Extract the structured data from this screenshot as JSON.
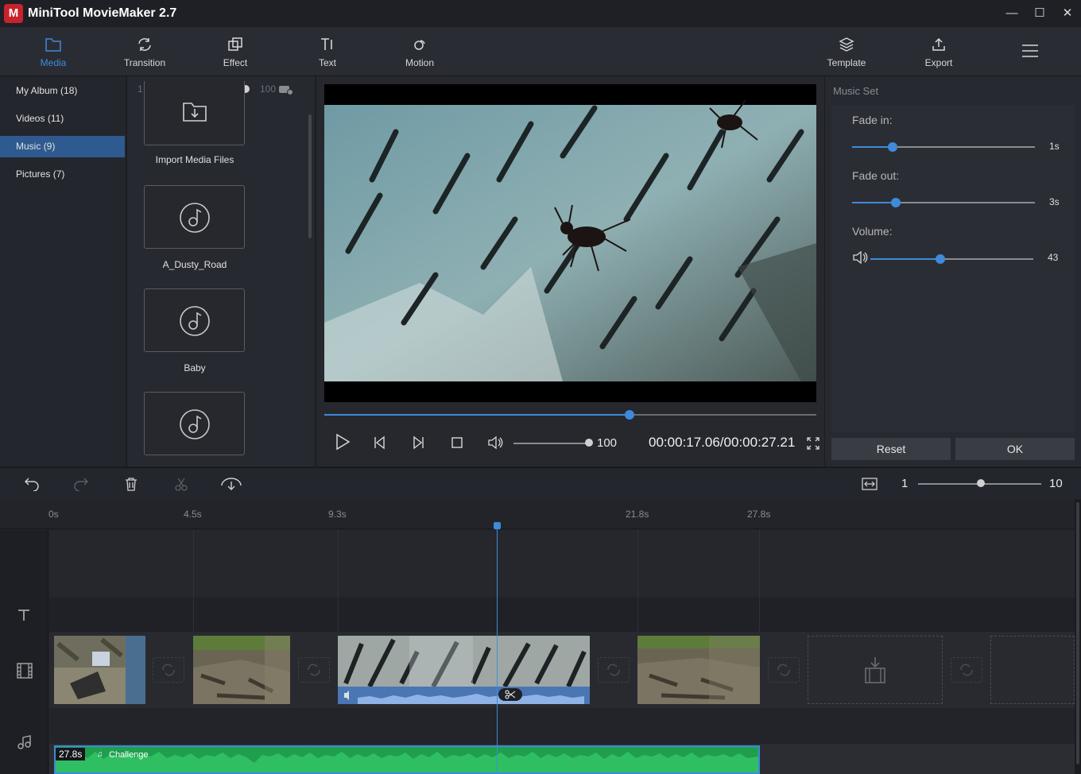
{
  "window": {
    "title": "MiniTool MovieMaker 2.7",
    "logo_glyph": "M",
    "minimize": "—",
    "maximize": "☐",
    "close": "✕"
  },
  "toolbar": {
    "tabs": [
      {
        "label": "Media",
        "icon": "folder-icon",
        "active": true
      },
      {
        "label": "Transition",
        "icon": "transition-icon"
      },
      {
        "label": "Effect",
        "icon": "effect-icon"
      },
      {
        "label": "Text",
        "icon": "text-icon"
      },
      {
        "label": "Motion",
        "icon": "motion-icon"
      }
    ],
    "right": [
      {
        "label": "Template",
        "icon": "layers-icon"
      },
      {
        "label": "Export",
        "icon": "export-icon"
      }
    ]
  },
  "album": {
    "items": [
      {
        "label": "My Album",
        "count": "(18)"
      },
      {
        "label": "Videos",
        "count": "(11)"
      },
      {
        "label": "Music",
        "count": "(9)",
        "active": true
      },
      {
        "label": "Pictures",
        "count": "(7)"
      }
    ]
  },
  "library": {
    "zoom_min": "1",
    "zoom_max": "100",
    "zoom_level": 1.0,
    "items": [
      {
        "label": "Import Media Files",
        "icon": "import-icon"
      },
      {
        "label": "A_Dusty_Road",
        "icon": "music-disc-icon"
      },
      {
        "label": "Baby",
        "icon": "music-disc-icon"
      },
      {
        "label": "",
        "icon": "music-disc-icon"
      }
    ]
  },
  "player": {
    "progress": 0.62,
    "volume_value": "100",
    "volume_level": 1.0,
    "timecode": "00:00:17.06/00:00:27.21"
  },
  "music_set": {
    "title": "Music Set",
    "fade_in_label": "Fade in:",
    "fade_in_value": "1s",
    "fade_in_level": 0.22,
    "fade_out_label": "Fade out:",
    "fade_out_value": "3s",
    "fade_out_level": 0.24,
    "volume_label": "Volume:",
    "volume_value": "43",
    "volume_level": 0.43,
    "reset_label": "Reset",
    "ok_label": "OK"
  },
  "timeline_toolbar": {
    "zoom_min": "1",
    "zoom_max": "10",
    "zoom_level": 0.51
  },
  "timeline": {
    "ruler": [
      "0s",
      "4.5s",
      "9.3s",
      "21.8s",
      "27.8s"
    ],
    "music_clip": {
      "duration": "27.8s",
      "name": "Challenge"
    }
  },
  "colors": {
    "accent": "#3f8ad9",
    "music_green": "#1f9e4d",
    "panel": "#272930"
  }
}
